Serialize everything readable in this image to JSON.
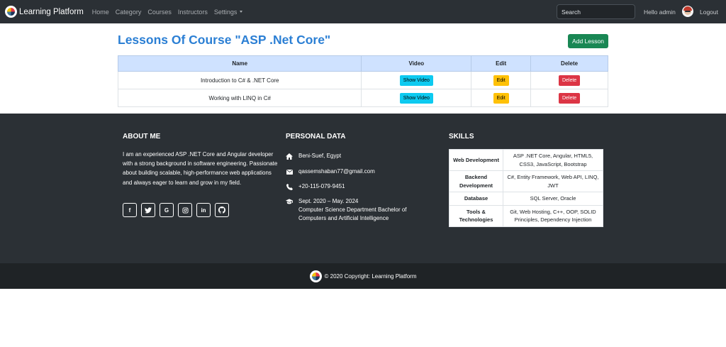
{
  "navbar": {
    "brand": "Learning Platform",
    "links": [
      "Home",
      "Category",
      "Courses",
      "Instructors",
      "Settings"
    ],
    "search_placeholder": "Search",
    "greeting": "Hello admin",
    "logout": "Logout"
  },
  "main": {
    "title": "Lessons Of Course \"ASP .Net Core\"",
    "add_button": "Add Lesson",
    "table": {
      "headers": [
        "Name",
        "Video",
        "Edit",
        "Delete"
      ],
      "rows": [
        {
          "name": "Introduction to C# & .NET Core",
          "video": "Show Video",
          "edit": "Edit",
          "delete": "Delete"
        },
        {
          "name": "Working with LINQ in C#",
          "video": "Show Video",
          "edit": "Edit",
          "delete": "Delete"
        }
      ]
    }
  },
  "footer": {
    "about": {
      "heading": "ABOUT ME",
      "text": "I am an experienced ASP .NET Core and Angular developer with a strong background in software engineering. Passionate about building scalable, high-performance web applications and always eager to learn and grow in my field.",
      "socials": [
        "facebook-icon",
        "twitter-icon",
        "google-icon",
        "instagram-icon",
        "linkedin-icon",
        "github-icon"
      ]
    },
    "personal": {
      "heading": "PERSONAL DATA",
      "location": "Beni-Suef, Egypt",
      "email": "qassemshaban77@gmail.com",
      "phone": "+20-115-079-9451",
      "education_date": "Sept. 2020 – May. 2024",
      "education_desc": "Computer Science Department Bachelor of Computers and Artificial Intelligence"
    },
    "skills": {
      "heading": "SKILLS",
      "rows": [
        {
          "key": "Web Development",
          "value": "ASP .NET Core, Angular, HTML5, CSS3, JavaScript, Bootstrap"
        },
        {
          "key": "Backend Development",
          "value": "C#, Entity Framework, Web API, LINQ, JWT"
        },
        {
          "key": "Database",
          "value": "SQL Server, Oracle"
        },
        {
          "key": "Tools & Technologies",
          "value": "Git, Web Hosting, C++, OOP, SOLID Principles, Dependency Injection"
        }
      ]
    }
  },
  "copyright": "© 2020 Copyright: Learning Platform"
}
